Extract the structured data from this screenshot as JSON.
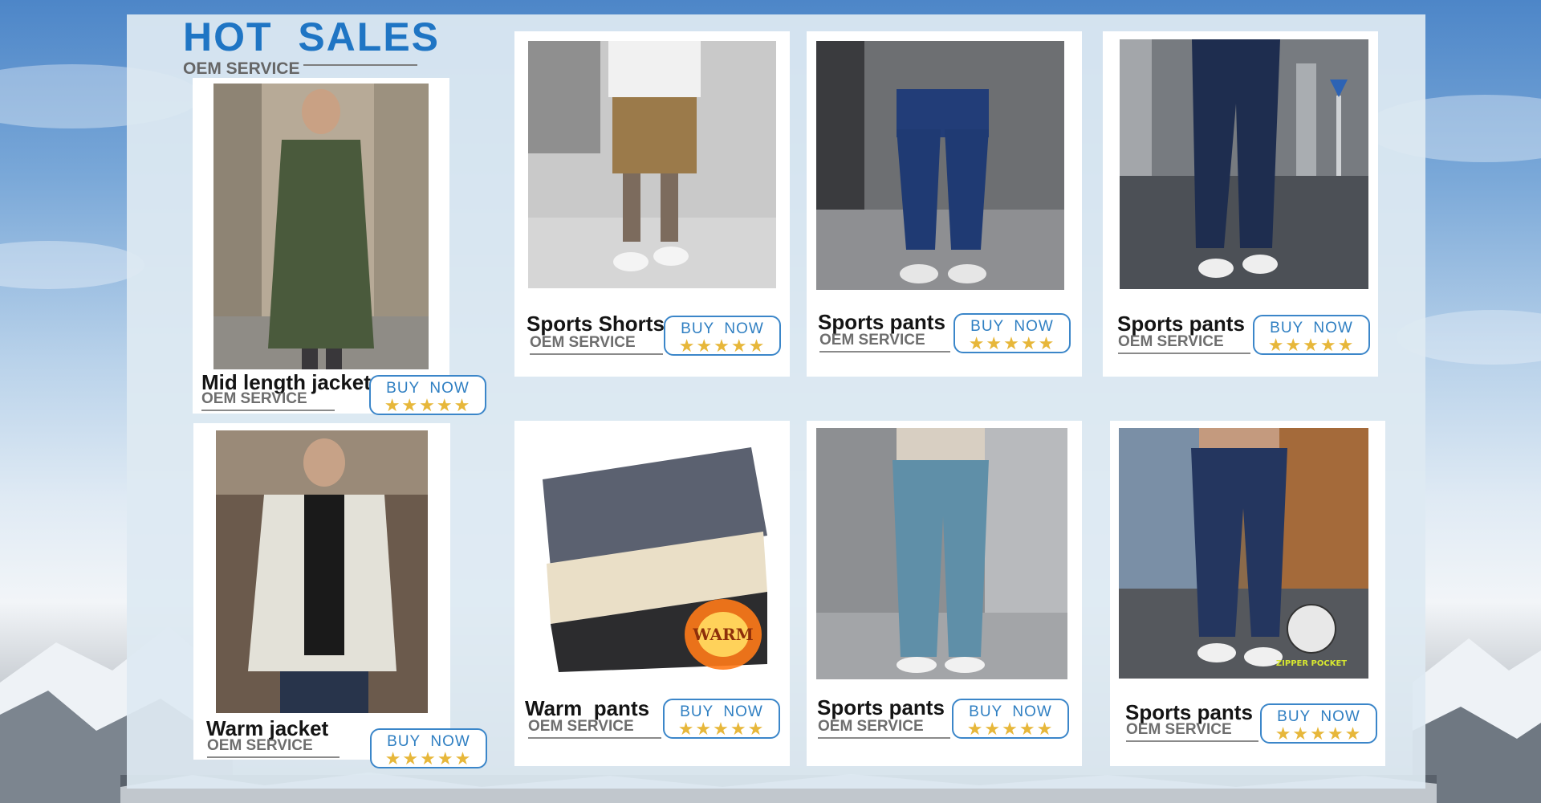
{
  "header": {
    "title": "HOT  SALES",
    "subtitle": "OEM SERVICE"
  },
  "colors": {
    "accent": "#1f75c4",
    "button_border": "#3b86c9",
    "star": "#e7b73a"
  },
  "products": [
    {
      "name": "Mid length jacket",
      "oem": "OEM SERVICE",
      "buy": "BUY  NOW",
      "stars": "★★★★★",
      "rating": 5
    },
    {
      "name": "Sports Shorts",
      "oem": "OEM SERVICE",
      "buy": "BUY  NOW",
      "stars": "★★★★★",
      "rating": 5
    },
    {
      "name": "Sports pants",
      "oem": "OEM SERVICE",
      "buy": "BUY  NOW",
      "stars": "★★★★★",
      "rating": 5
    },
    {
      "name": "Sports pants",
      "oem": "OEM SERVICE",
      "buy": "BUY  NOW",
      "stars": "★★★★★",
      "rating": 5
    },
    {
      "name": "Warm jacket",
      "oem": "OEM SERVICE",
      "buy": "BUY  NOW",
      "stars": "★★★★★",
      "rating": 5
    },
    {
      "name": "Warm  pants",
      "oem": "OEM SERVICE",
      "buy": "BUY  NOW",
      "stars": "★★★★★",
      "rating": 5,
      "badge": "WARM"
    },
    {
      "name": "Sports pants",
      "oem": "OEM SERVICE",
      "buy": "BUY  NOW",
      "stars": "★★★★★",
      "rating": 5
    },
    {
      "name": "Sports pants",
      "oem": "OEM SERVICE",
      "buy": "BUY  NOW",
      "stars": "★★★★★",
      "rating": 5,
      "badge": "ZIPPER POCKET"
    }
  ]
}
